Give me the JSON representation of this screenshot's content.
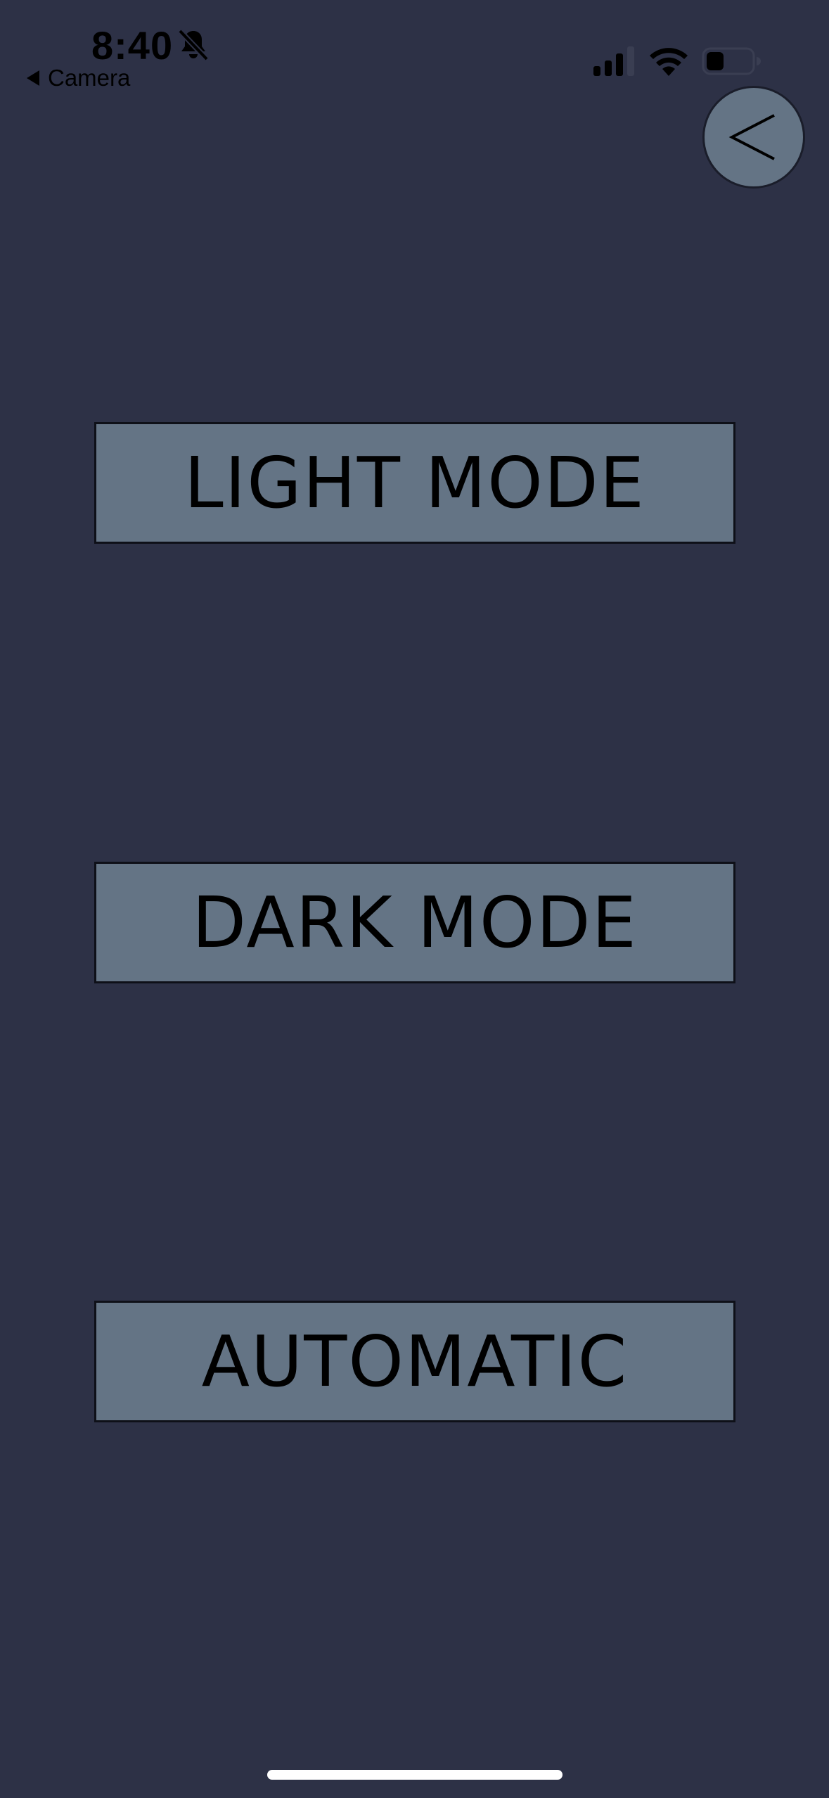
{
  "status_bar": {
    "time": "8:40",
    "back_app_label": "Camera",
    "icons": [
      "bell-slash-icon",
      "cellular-signal-icon",
      "wifi-icon",
      "battery-icon"
    ]
  },
  "nav": {
    "back_button_icon": "chevron-left-icon"
  },
  "modes": {
    "light_label": "LIGHT MODE",
    "dark_label": "DARK MODE",
    "auto_label": "AUTOMATIC"
  },
  "colors": {
    "background": "#2d3146",
    "button_fill": "#647485",
    "text": "#000000"
  }
}
